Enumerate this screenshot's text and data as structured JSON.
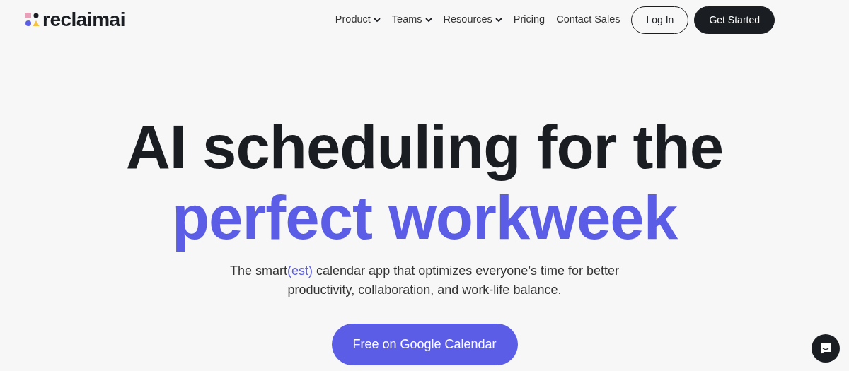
{
  "logo": {
    "text": "reclaimai"
  },
  "nav": [
    {
      "label": "Product",
      "dropdown": true
    },
    {
      "label": "Teams",
      "dropdown": true
    },
    {
      "label": "Resources",
      "dropdown": true
    },
    {
      "label": "Pricing",
      "dropdown": false
    },
    {
      "label": "Contact Sales",
      "dropdown": false
    }
  ],
  "buttons": [
    {
      "label": "Log In",
      "kind": "outline"
    },
    {
      "label": "Get Started",
      "kind": "dark"
    }
  ],
  "hero": {
    "lines": [
      {
        "text": "AI scheduling for the",
        "accent": false
      },
      {
        "text": "perfect workweek",
        "accent": true
      }
    ],
    "subtitle": [
      {
        "text": "The smart",
        "accent": false
      },
      {
        "text": "(est)",
        "accent": true
      },
      {
        "text": " calendar app that optimizes everyone’s time for better productivity, collaboration, and work-life balance.",
        "accent": false
      }
    ],
    "cta": "Free on Google Calendar"
  }
}
